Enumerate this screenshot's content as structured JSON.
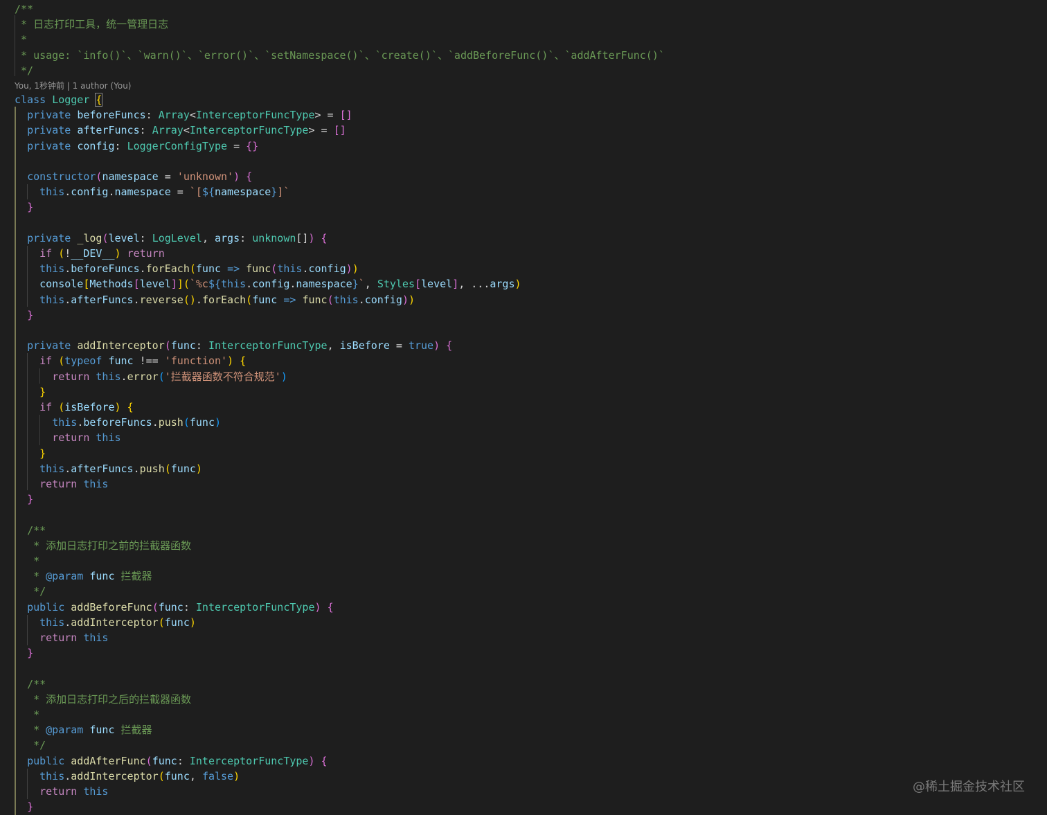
{
  "editor": {
    "author_lens": "You, 1秒钟前 | 1 author (You)",
    "watermark": "@稀土掘金技术社区",
    "colors": {
      "background": "#1e1e1e",
      "keyword": "#569cd6",
      "control": "#c586c0",
      "property": "#9cdcfe",
      "type": "#4ec9b0",
      "function": "#dcdcaa",
      "string": "#ce9178",
      "comment": "#6a9955",
      "bracket_1": "#da70d6",
      "bracket_2": "#ffd700",
      "bracket_3": "#179fff"
    }
  },
  "code": [
    [
      [
        "com",
        "/**"
      ]
    ],
    [
      [
        "com",
        " * 日志打印工具，统一管理日志"
      ]
    ],
    [
      [
        "com",
        " *"
      ]
    ],
    [
      [
        "com",
        " * usage: `info()`、`warn()`、`error()`、`setNamespace()`、`create()`、`addBeforeFunc()`、`addAfterFunc()`"
      ]
    ],
    [
      [
        "com",
        " */"
      ]
    ],
    [
      [
        "kw",
        "class"
      ],
      [
        "op",
        " "
      ],
      [
        "type",
        "Logger"
      ],
      [
        "op",
        " "
      ],
      [
        "br",
        "{"
      ]
    ],
    [
      [
        "op",
        "  "
      ],
      [
        "kw",
        "private"
      ],
      [
        "op",
        " "
      ],
      [
        "prop",
        "beforeFuncs"
      ],
      [
        "op",
        ": "
      ],
      [
        "type",
        "Array"
      ],
      [
        "op",
        "<"
      ],
      [
        "type",
        "InterceptorFuncType"
      ],
      [
        "op",
        "> = "
      ],
      [
        "p1",
        "[]"
      ]
    ],
    [
      [
        "op",
        "  "
      ],
      [
        "kw",
        "private"
      ],
      [
        "op",
        " "
      ],
      [
        "prop",
        "afterFuncs"
      ],
      [
        "op",
        ": "
      ],
      [
        "type",
        "Array"
      ],
      [
        "op",
        "<"
      ],
      [
        "type",
        "InterceptorFuncType"
      ],
      [
        "op",
        "> = "
      ],
      [
        "p1",
        "[]"
      ]
    ],
    [
      [
        "op",
        "  "
      ],
      [
        "kw",
        "private"
      ],
      [
        "op",
        " "
      ],
      [
        "prop",
        "config"
      ],
      [
        "op",
        ": "
      ],
      [
        "type",
        "LoggerConfigType"
      ],
      [
        "op",
        " = "
      ],
      [
        "p1",
        "{}"
      ]
    ],
    [],
    [
      [
        "op",
        "  "
      ],
      [
        "kw",
        "constructor"
      ],
      [
        "p1",
        "("
      ],
      [
        "prop",
        "namespace"
      ],
      [
        "op",
        " = "
      ],
      [
        "str",
        "'unknown'"
      ],
      [
        "p1",
        ")"
      ],
      [
        "op",
        " "
      ],
      [
        "p1",
        "{"
      ]
    ],
    [
      [
        "op",
        "    "
      ],
      [
        "kw",
        "this"
      ],
      [
        "op",
        "."
      ],
      [
        "prop",
        "config"
      ],
      [
        "op",
        "."
      ],
      [
        "prop",
        "namespace"
      ],
      [
        "op",
        " = "
      ],
      [
        "str",
        "`["
      ],
      [
        "kw",
        "${"
      ],
      [
        "prop",
        "namespace"
      ],
      [
        "kw",
        "}"
      ],
      [
        "str",
        "]`"
      ]
    ],
    [
      [
        "op",
        "  "
      ],
      [
        "p1",
        "}"
      ]
    ],
    [],
    [
      [
        "op",
        "  "
      ],
      [
        "kw",
        "private"
      ],
      [
        "op",
        " "
      ],
      [
        "fn",
        "_log"
      ],
      [
        "p1",
        "("
      ],
      [
        "prop",
        "level"
      ],
      [
        "op",
        ": "
      ],
      [
        "type",
        "LogLevel"
      ],
      [
        "op",
        ", "
      ],
      [
        "prop",
        "args"
      ],
      [
        "op",
        ": "
      ],
      [
        "type",
        "unknown"
      ],
      [
        "op",
        "[]"
      ],
      [
        "p1",
        ")"
      ],
      [
        "op",
        " "
      ],
      [
        "p1",
        "{"
      ]
    ],
    [
      [
        "op",
        "    "
      ],
      [
        "ctl",
        "if"
      ],
      [
        "op",
        " "
      ],
      [
        "p2",
        "("
      ],
      [
        "op",
        "!"
      ],
      [
        "prop",
        "__DEV__"
      ],
      [
        "p2",
        ")"
      ],
      [
        "op",
        " "
      ],
      [
        "ctl",
        "return"
      ]
    ],
    [
      [
        "op",
        "    "
      ],
      [
        "kw",
        "this"
      ],
      [
        "op",
        "."
      ],
      [
        "prop",
        "beforeFuncs"
      ],
      [
        "op",
        "."
      ],
      [
        "fn",
        "forEach"
      ],
      [
        "p2",
        "("
      ],
      [
        "prop",
        "func"
      ],
      [
        "op",
        " "
      ],
      [
        "kw",
        "=>"
      ],
      [
        "op",
        " "
      ],
      [
        "fn",
        "func"
      ],
      [
        "p1",
        "("
      ],
      [
        "kw",
        "this"
      ],
      [
        "op",
        "."
      ],
      [
        "prop",
        "config"
      ],
      [
        "p1",
        ")"
      ],
      [
        "p2",
        ")"
      ]
    ],
    [
      [
        "op",
        "    "
      ],
      [
        "prop",
        "console"
      ],
      [
        "p2",
        "["
      ],
      [
        "prop",
        "Methods"
      ],
      [
        "p1",
        "["
      ],
      [
        "prop",
        "level"
      ],
      [
        "p1",
        "]"
      ],
      [
        "p2",
        "]"
      ],
      [
        "p2",
        "("
      ],
      [
        "str",
        "`%c"
      ],
      [
        "kw",
        "${"
      ],
      [
        "kw",
        "this"
      ],
      [
        "op",
        "."
      ],
      [
        "prop",
        "config"
      ],
      [
        "op",
        "."
      ],
      [
        "prop",
        "namespace"
      ],
      [
        "kw",
        "}"
      ],
      [
        "str",
        "`"
      ],
      [
        "op",
        ", "
      ],
      [
        "type",
        "Styles"
      ],
      [
        "p1",
        "["
      ],
      [
        "prop",
        "level"
      ],
      [
        "p1",
        "]"
      ],
      [
        "op",
        ", ..."
      ],
      [
        "prop",
        "args"
      ],
      [
        "p2",
        ")"
      ]
    ],
    [
      [
        "op",
        "    "
      ],
      [
        "kw",
        "this"
      ],
      [
        "op",
        "."
      ],
      [
        "prop",
        "afterFuncs"
      ],
      [
        "op",
        "."
      ],
      [
        "fn",
        "reverse"
      ],
      [
        "p2",
        "()"
      ],
      [
        "op",
        "."
      ],
      [
        "fn",
        "forEach"
      ],
      [
        "p2",
        "("
      ],
      [
        "prop",
        "func"
      ],
      [
        "op",
        " "
      ],
      [
        "kw",
        "=>"
      ],
      [
        "op",
        " "
      ],
      [
        "fn",
        "func"
      ],
      [
        "p1",
        "("
      ],
      [
        "kw",
        "this"
      ],
      [
        "op",
        "."
      ],
      [
        "prop",
        "config"
      ],
      [
        "p1",
        ")"
      ],
      [
        "p2",
        ")"
      ]
    ],
    [
      [
        "op",
        "  "
      ],
      [
        "p1",
        "}"
      ]
    ],
    [],
    [
      [
        "op",
        "  "
      ],
      [
        "kw",
        "private"
      ],
      [
        "op",
        " "
      ],
      [
        "fn",
        "addInterceptor"
      ],
      [
        "p1",
        "("
      ],
      [
        "prop",
        "func"
      ],
      [
        "op",
        ": "
      ],
      [
        "type",
        "InterceptorFuncType"
      ],
      [
        "op",
        ", "
      ],
      [
        "prop",
        "isBefore"
      ],
      [
        "op",
        " = "
      ],
      [
        "kw",
        "true"
      ],
      [
        "p1",
        ")"
      ],
      [
        "op",
        " "
      ],
      [
        "p1",
        "{"
      ]
    ],
    [
      [
        "op",
        "    "
      ],
      [
        "ctl",
        "if"
      ],
      [
        "op",
        " "
      ],
      [
        "p2",
        "("
      ],
      [
        "kw",
        "typeof"
      ],
      [
        "op",
        " "
      ],
      [
        "prop",
        "func"
      ],
      [
        "op",
        " !== "
      ],
      [
        "str",
        "'function'"
      ],
      [
        "p2",
        ")"
      ],
      [
        "op",
        " "
      ],
      [
        "p2",
        "{"
      ]
    ],
    [
      [
        "op",
        "      "
      ],
      [
        "ctl",
        "return"
      ],
      [
        "op",
        " "
      ],
      [
        "kw",
        "this"
      ],
      [
        "op",
        "."
      ],
      [
        "fn",
        "error"
      ],
      [
        "p3",
        "("
      ],
      [
        "str",
        "'拦截器函数不符合规范'"
      ],
      [
        "p3",
        ")"
      ]
    ],
    [
      [
        "op",
        "    "
      ],
      [
        "p2",
        "}"
      ]
    ],
    [
      [
        "op",
        "    "
      ],
      [
        "ctl",
        "if"
      ],
      [
        "op",
        " "
      ],
      [
        "p2",
        "("
      ],
      [
        "prop",
        "isBefore"
      ],
      [
        "p2",
        ")"
      ],
      [
        "op",
        " "
      ],
      [
        "p2",
        "{"
      ]
    ],
    [
      [
        "op",
        "      "
      ],
      [
        "kw",
        "this"
      ],
      [
        "op",
        "."
      ],
      [
        "prop",
        "beforeFuncs"
      ],
      [
        "op",
        "."
      ],
      [
        "fn",
        "push"
      ],
      [
        "p3",
        "("
      ],
      [
        "prop",
        "func"
      ],
      [
        "p3",
        ")"
      ]
    ],
    [
      [
        "op",
        "      "
      ],
      [
        "ctl",
        "return"
      ],
      [
        "op",
        " "
      ],
      [
        "kw",
        "this"
      ]
    ],
    [
      [
        "op",
        "    "
      ],
      [
        "p2",
        "}"
      ]
    ],
    [
      [
        "op",
        "    "
      ],
      [
        "kw",
        "this"
      ],
      [
        "op",
        "."
      ],
      [
        "prop",
        "afterFuncs"
      ],
      [
        "op",
        "."
      ],
      [
        "fn",
        "push"
      ],
      [
        "p2",
        "("
      ],
      [
        "prop",
        "func"
      ],
      [
        "p2",
        ")"
      ]
    ],
    [
      [
        "op",
        "    "
      ],
      [
        "ctl",
        "return"
      ],
      [
        "op",
        " "
      ],
      [
        "kw",
        "this"
      ]
    ],
    [
      [
        "op",
        "  "
      ],
      [
        "p1",
        "}"
      ]
    ],
    [],
    [
      [
        "op",
        "  "
      ],
      [
        "com",
        "/**"
      ]
    ],
    [
      [
        "op",
        "  "
      ],
      [
        "com",
        " * 添加日志打印之前的拦截器函数"
      ]
    ],
    [
      [
        "op",
        "  "
      ],
      [
        "com",
        " *"
      ]
    ],
    [
      [
        "op",
        "  "
      ],
      [
        "com",
        " * "
      ],
      [
        "tag",
        "@param"
      ],
      [
        "op",
        " "
      ],
      [
        "prop",
        "func"
      ],
      [
        "com",
        " 拦截器"
      ]
    ],
    [
      [
        "op",
        "  "
      ],
      [
        "com",
        " */"
      ]
    ],
    [
      [
        "op",
        "  "
      ],
      [
        "kw",
        "public"
      ],
      [
        "op",
        " "
      ],
      [
        "fn",
        "addBeforeFunc"
      ],
      [
        "p1",
        "("
      ],
      [
        "prop",
        "func"
      ],
      [
        "op",
        ": "
      ],
      [
        "type",
        "InterceptorFuncType"
      ],
      [
        "p1",
        ")"
      ],
      [
        "op",
        " "
      ],
      [
        "p1",
        "{"
      ]
    ],
    [
      [
        "op",
        "    "
      ],
      [
        "kw",
        "this"
      ],
      [
        "op",
        "."
      ],
      [
        "fn",
        "addInterceptor"
      ],
      [
        "p2",
        "("
      ],
      [
        "prop",
        "func"
      ],
      [
        "p2",
        ")"
      ]
    ],
    [
      [
        "op",
        "    "
      ],
      [
        "ctl",
        "return"
      ],
      [
        "op",
        " "
      ],
      [
        "kw",
        "this"
      ]
    ],
    [
      [
        "op",
        "  "
      ],
      [
        "p1",
        "}"
      ]
    ],
    [],
    [
      [
        "op",
        "  "
      ],
      [
        "com",
        "/**"
      ]
    ],
    [
      [
        "op",
        "  "
      ],
      [
        "com",
        " * 添加日志打印之后的拦截器函数"
      ]
    ],
    [
      [
        "op",
        "  "
      ],
      [
        "com",
        " *"
      ]
    ],
    [
      [
        "op",
        "  "
      ],
      [
        "com",
        " * "
      ],
      [
        "tag",
        "@param"
      ],
      [
        "op",
        " "
      ],
      [
        "prop",
        "func"
      ],
      [
        "com",
        " 拦截器"
      ]
    ],
    [
      [
        "op",
        "  "
      ],
      [
        "com",
        " */"
      ]
    ],
    [
      [
        "op",
        "  "
      ],
      [
        "kw",
        "public"
      ],
      [
        "op",
        " "
      ],
      [
        "fn",
        "addAfterFunc"
      ],
      [
        "p1",
        "("
      ],
      [
        "prop",
        "func"
      ],
      [
        "op",
        ": "
      ],
      [
        "type",
        "InterceptorFuncType"
      ],
      [
        "p1",
        ")"
      ],
      [
        "op",
        " "
      ],
      [
        "p1",
        "{"
      ]
    ],
    [
      [
        "op",
        "    "
      ],
      [
        "kw",
        "this"
      ],
      [
        "op",
        "."
      ],
      [
        "fn",
        "addInterceptor"
      ],
      [
        "p2",
        "("
      ],
      [
        "prop",
        "func"
      ],
      [
        "op",
        ", "
      ],
      [
        "kw",
        "false"
      ],
      [
        "p2",
        ")"
      ]
    ],
    [
      [
        "op",
        "    "
      ],
      [
        "ctl",
        "return"
      ],
      [
        "op",
        " "
      ],
      [
        "kw",
        "this"
      ]
    ],
    [
      [
        "op",
        "  "
      ],
      [
        "p1",
        "}"
      ]
    ]
  ]
}
